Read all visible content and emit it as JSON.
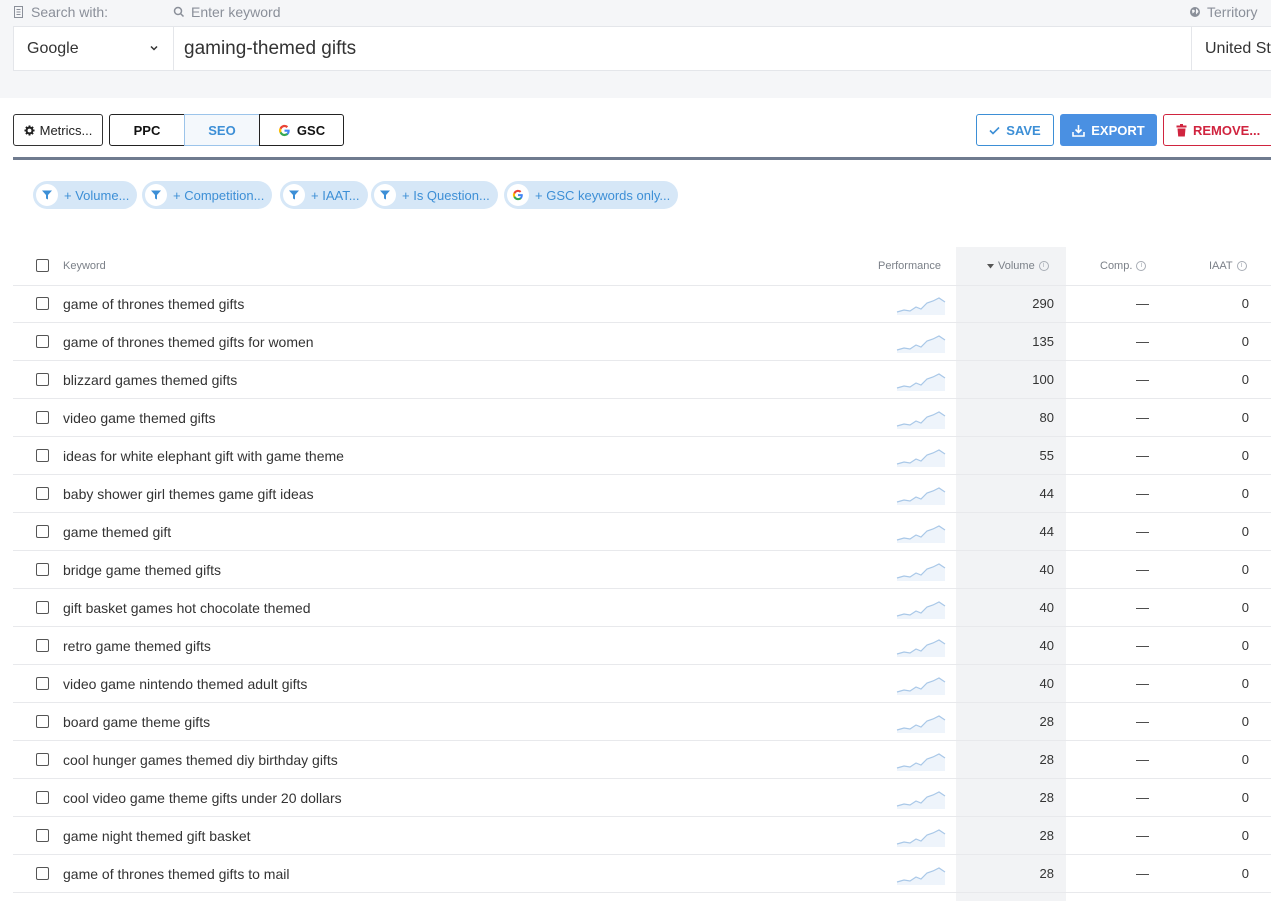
{
  "search": {
    "search_with_label": "Search with:",
    "keyword_label": "Enter keyword",
    "territory_label": "Territory",
    "engine": "Google",
    "keyword": "gaming-themed gifts",
    "territory": "United States"
  },
  "toolbar": {
    "metrics_label": "Metrics...",
    "ppc_label": "PPC",
    "seo_label": "SEO",
    "gsc_label": "GSC",
    "save_label": "SAVE",
    "export_label": "EXPORT",
    "remove_label": "REMOVE..."
  },
  "filters": [
    {
      "label": "+ Volume..."
    },
    {
      "label": "+ Competition..."
    },
    {
      "label": "+ IAAT..."
    },
    {
      "label": "+ Is Question..."
    },
    {
      "label": "+ GSC keywords only..."
    }
  ],
  "table": {
    "columns": {
      "keyword": "Keyword",
      "performance": "Performance",
      "volume": "Volume",
      "comp": "Comp.",
      "iaat": "IAAT"
    },
    "rows": [
      {
        "keyword": "game of thrones themed gifts",
        "volume": "290",
        "comp": "—",
        "iaat": "0"
      },
      {
        "keyword": "game of thrones themed gifts for women",
        "volume": "135",
        "comp": "—",
        "iaat": "0"
      },
      {
        "keyword": "blizzard games themed gifts",
        "volume": "100",
        "comp": "—",
        "iaat": "0"
      },
      {
        "keyword": "video game themed gifts",
        "volume": "80",
        "comp": "—",
        "iaat": "0"
      },
      {
        "keyword": "ideas for white elephant gift with game theme",
        "volume": "55",
        "comp": "—",
        "iaat": "0"
      },
      {
        "keyword": "baby shower girl themes game gift ideas",
        "volume": "44",
        "comp": "—",
        "iaat": "0"
      },
      {
        "keyword": "game themed gift",
        "volume": "44",
        "comp": "—",
        "iaat": "0"
      },
      {
        "keyword": "bridge game themed gifts",
        "volume": "40",
        "comp": "—",
        "iaat": "0"
      },
      {
        "keyword": "gift basket games hot chocolate themed",
        "volume": "40",
        "comp": "—",
        "iaat": "0"
      },
      {
        "keyword": "retro game themed gifts",
        "volume": "40",
        "comp": "—",
        "iaat": "0"
      },
      {
        "keyword": "video game nintendo themed adult gifts",
        "volume": "40",
        "comp": "—",
        "iaat": "0"
      },
      {
        "keyword": "board game theme gifts",
        "volume": "28",
        "comp": "—",
        "iaat": "0"
      },
      {
        "keyword": "cool hunger games themed diy birthday gifts",
        "volume": "28",
        "comp": "—",
        "iaat": "0"
      },
      {
        "keyword": "cool video game theme gifts under 20 dollars",
        "volume": "28",
        "comp": "—",
        "iaat": "0"
      },
      {
        "keyword": "game night themed gift basket",
        "volume": "28",
        "comp": "—",
        "iaat": "0"
      },
      {
        "keyword": "game of thrones themed gifts to mail",
        "volume": "28",
        "comp": "—",
        "iaat": "0"
      }
    ]
  },
  "colors": {
    "accent": "#3d8fd6",
    "export_bg": "#4a90e2",
    "danger": "#d0243f",
    "chip_bg": "#d6e7f7",
    "sparkline": "#a9c8e8"
  }
}
